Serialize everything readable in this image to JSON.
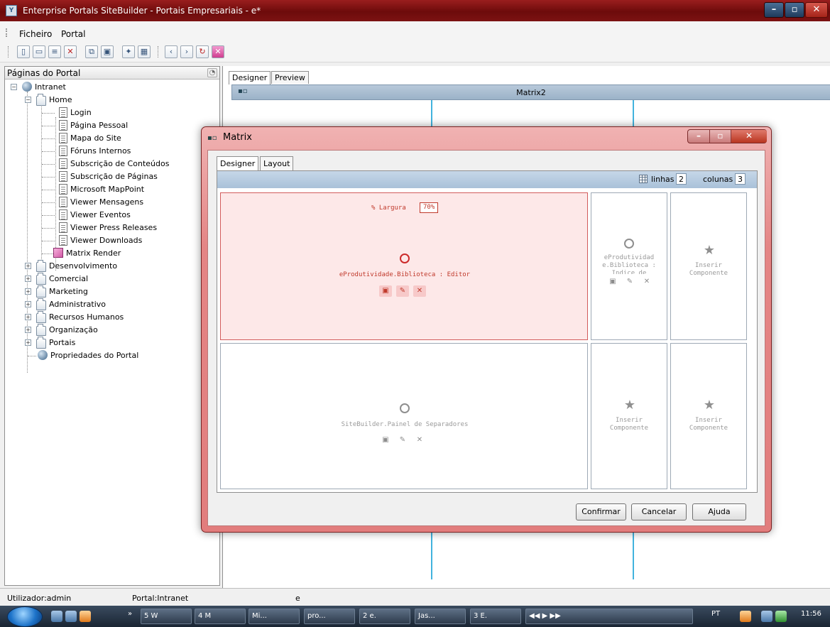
{
  "window": {
    "title": "Enterprise Portals SiteBuilder - Portais Empresariais - e*",
    "icon_label": "Υ"
  },
  "menu": {
    "items": [
      "Ficheiro",
      "Portal"
    ]
  },
  "toolbar": {
    "icons": [
      "new-page-icon",
      "new-folder-icon",
      "properties-icon",
      "delete-icon",
      "copy-icon",
      "paste-icon",
      "component-icon",
      "matrix-icon",
      "back-icon",
      "forward-icon",
      "refresh-icon",
      "close-icon"
    ]
  },
  "left_panel": {
    "title": "Páginas do Portal",
    "tree": {
      "root": "Intranet",
      "home": "Home",
      "home_children": [
        "Login",
        "Página Pessoal",
        "Mapa do Site",
        "Fóruns Internos",
        "Subscrição de Conteúdos",
        "Subscrição de Páginas",
        "Microsoft MapPoint",
        "Viewer Mensagens",
        "Viewer Eventos",
        "Viewer Press Releases",
        "Viewer Downloads",
        "Matrix Render"
      ],
      "folders": [
        "Desenvolvimento",
        "Comercial",
        "Marketing",
        "Administrativo",
        "Recursos Humanos",
        "Organização",
        "Portais"
      ],
      "properties": "Propriedades do Portal"
    }
  },
  "designer": {
    "tabs": [
      "Designer",
      "Preview"
    ],
    "matrix_title": "Matrix2"
  },
  "dialog": {
    "title": "Matrix",
    "tabs": [
      "Designer",
      "Layout"
    ],
    "rows_label": "linhas",
    "rows_value": "2",
    "cols_label": "colunas",
    "cols_value": "3",
    "width_label": "% Largura",
    "width_value": "70%",
    "cells": {
      "r1c1": "eProdutividade.Biblioteca : Editor",
      "r1c2": [
        "eProdutividad",
        "e.Biblioteca :",
        "Indice de"
      ],
      "r1c3": [
        "Inserir",
        "Componente"
      ],
      "r2c1": "SiteBuilder.Painel de Separadores",
      "r2c2": [
        "Inserir",
        "Componente"
      ],
      "r2c3": [
        "Inserir",
        "Componente"
      ]
    },
    "buttons": {
      "confirm": "Confirmar",
      "cancel": "Cancelar",
      "help": "Ajuda"
    }
  },
  "statusbar": {
    "user": "Utilizador:admin",
    "portal": "Portal:Intranet",
    "extra": "e"
  },
  "taskbar": {
    "items": [
      "5 W",
      "4 M",
      "Mi...",
      "pro...",
      "2 e.",
      "Jas...",
      "3 E."
    ],
    "language": "PT",
    "time": "11:56"
  },
  "colors": {
    "titlebar": "#7c1212",
    "dialog_frame": "#e48585",
    "selected_cell": "#fde8e8",
    "accent_blue": "#42b3de"
  }
}
